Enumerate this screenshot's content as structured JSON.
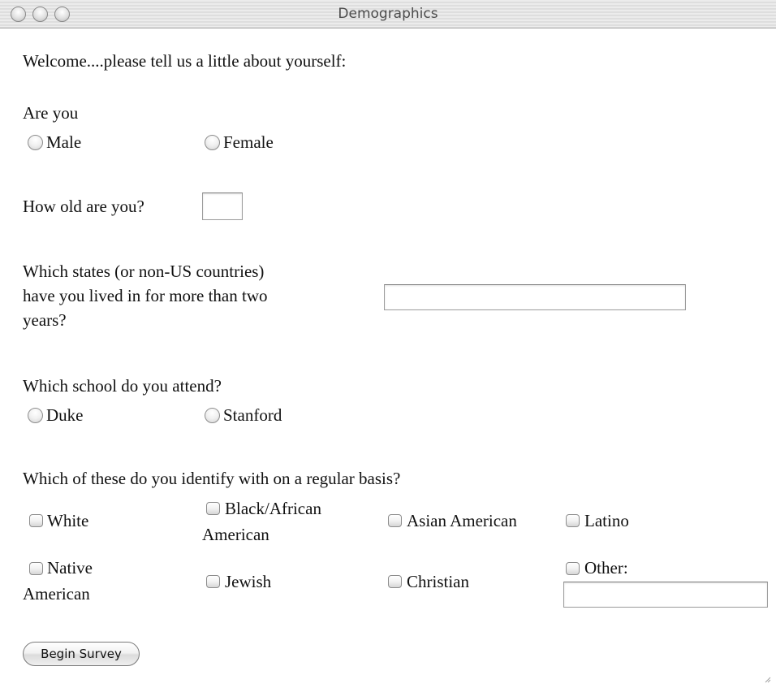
{
  "window": {
    "title": "Demographics"
  },
  "intro": "Welcome....please tell us a little about yourself:",
  "gender": {
    "question": "Are you",
    "options": [
      "Male",
      "Female"
    ]
  },
  "age": {
    "question": "How old are you?",
    "value": ""
  },
  "states": {
    "question_lines": [
      "Which states (or non-US countries)",
      "have you lived in for more than two",
      "years?"
    ],
    "value": ""
  },
  "school": {
    "question": "Which school do you attend?",
    "options": [
      "Duke",
      "Stanford"
    ]
  },
  "identity": {
    "question": "Which of these do you identify with on a regular basis?",
    "options": {
      "white": "White",
      "black_line1": "Black/African",
      "black_line2": "American",
      "asian": "Asian American",
      "latino": "Latino",
      "native_line1": "Native",
      "native_line2": "American",
      "jewish": "Jewish",
      "christian": "Christian",
      "other": "Other:"
    },
    "other_value": ""
  },
  "submit_label": "Begin Survey"
}
